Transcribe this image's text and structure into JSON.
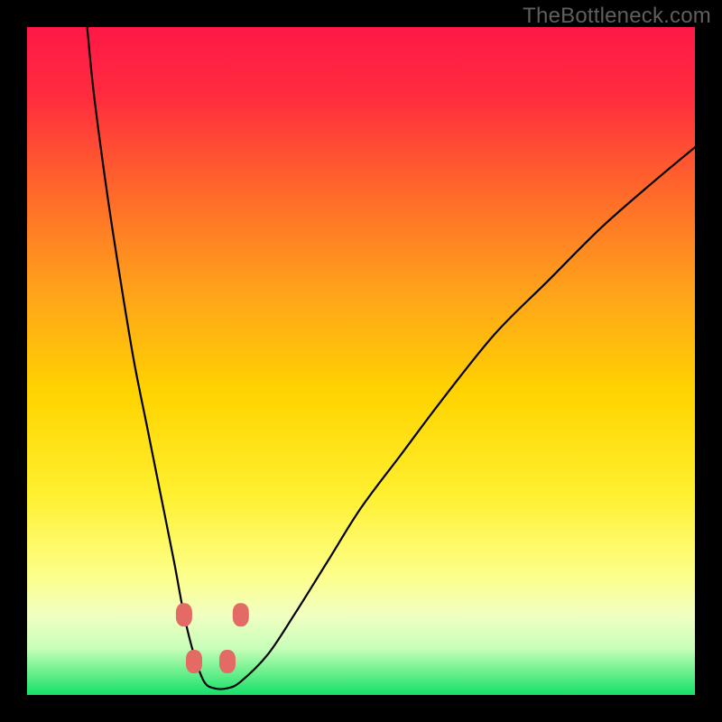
{
  "watermark": "TheBottleneck.com",
  "chart_data": {
    "type": "line",
    "title": "",
    "xlabel": "",
    "ylabel": "",
    "xlim": [
      0,
      100
    ],
    "ylim": [
      0,
      100
    ],
    "background_gradient": {
      "stops": [
        {
          "offset": 0.0,
          "color": "#ff1846"
        },
        {
          "offset": 0.1,
          "color": "#ff2b3f"
        },
        {
          "offset": 0.25,
          "color": "#ff6a2a"
        },
        {
          "offset": 0.4,
          "color": "#ffa41a"
        },
        {
          "offset": 0.55,
          "color": "#ffd400"
        },
        {
          "offset": 0.7,
          "color": "#fff030"
        },
        {
          "offset": 0.82,
          "color": "#fdff89"
        },
        {
          "offset": 0.88,
          "color": "#f1ffc1"
        },
        {
          "offset": 0.93,
          "color": "#c8ffb9"
        },
        {
          "offset": 0.965,
          "color": "#6df08e"
        },
        {
          "offset": 1.0,
          "color": "#14e06a"
        }
      ]
    },
    "series": [
      {
        "name": "bottleneck-curve",
        "x": [
          9,
          10,
          12,
          14,
          16,
          18,
          20,
          22,
          23.5,
          25,
          26.5,
          28,
          30,
          32,
          36,
          40,
          45,
          50,
          56,
          62,
          70,
          78,
          86,
          94,
          100
        ],
        "y": [
          100,
          90,
          75,
          62,
          50,
          40,
          30,
          20,
          12,
          6,
          2,
          1,
          1,
          2,
          6,
          12,
          20,
          28,
          36,
          44,
          54,
          62,
          70,
          77,
          82
        ]
      }
    ],
    "markers": [
      {
        "x": 23.5,
        "y": 12,
        "color": "#e46a66"
      },
      {
        "x": 32.0,
        "y": 12,
        "color": "#e46a66"
      },
      {
        "x": 25.0,
        "y": 5,
        "color": "#e46a66"
      },
      {
        "x": 30.0,
        "y": 5,
        "color": "#e46a66"
      }
    ]
  }
}
